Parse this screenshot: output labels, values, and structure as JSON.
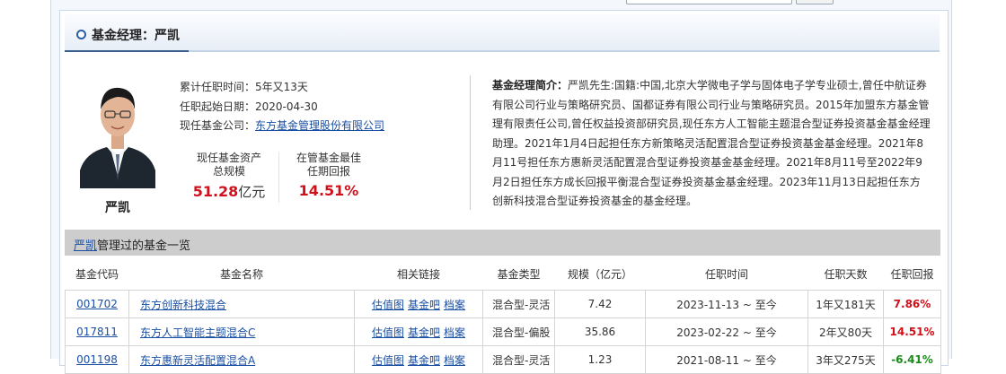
{
  "section": {
    "title": "基金经理：严凯"
  },
  "manager": {
    "name": "严凯",
    "tenure_label": "累计任职时间：",
    "tenure_value": "5年又13天",
    "start_label": "任职起始日期：",
    "start_value": "2020-04-30",
    "company_label": "现任基金公司：",
    "company_value": "东方基金管理股份有限公司"
  },
  "stats": {
    "aum_label_1": "现任基金资产",
    "aum_label_2": "总规模",
    "aum_value": "51.28",
    "aum_unit": "亿元",
    "best_label_1": "在管基金最佳",
    "best_label_2": "任期回报",
    "best_value": "14.51%"
  },
  "bio": {
    "label": "基金经理简介：",
    "text": "严凯先生:国籍:中国,北京大学微电子学与固体电子学专业硕士,曾任中航证券有限公司行业与策略研究员、国都证券有限公司行业与策略研究员。2015年加盟东方基金管理有限责任公司,曾任权益投资部研究员,现任东方人工智能主题混合型证券投资基金基金经理助理。2021年1月4日起担任东方新策略灵活配置混合型证券投资基金基金经理。2021年8月11号担任东方惠新灵活配置混合型证券投资基金基金经理。2021年8月11号至2022年9月2日担任东方成长回报平衡混合型证券投资基金基金经理。2023年11月13日起担任东方创新科技混合型证券投资基金的基金经理。"
  },
  "list": {
    "name_link": "严凯",
    "title_suffix": "管理过的基金一览",
    "headers": [
      "基金代码",
      "基金名称",
      "相关链接",
      "基金类型",
      "规模（亿元）",
      "任职时间",
      "任职天数",
      "任职回报"
    ],
    "link_labels": [
      "估值图",
      "基金吧",
      "档案"
    ],
    "rows": [
      {
        "code": "001702",
        "name": "东方创新科技混合",
        "type": "混合型-灵活",
        "scale": "7.42",
        "period": "2023-11-13 ~ 至今",
        "days": "1年又181天",
        "return": "7.86%"
      },
      {
        "code": "017811",
        "name": "东方人工智能主题混合C",
        "type": "混合型-偏股",
        "scale": "35.86",
        "period": "2023-02-22 ~ 至今",
        "days": "2年又80天",
        "return": "14.51%"
      },
      {
        "code": "001198",
        "name": "东方惠新灵活配置混合A",
        "type": "混合型-灵活",
        "scale": "1.23",
        "period": "2021-08-11 ~ 至今",
        "days": "3年又275天",
        "return": "-6.41%"
      }
    ]
  },
  "colors": {
    "accent": "#1a4fa3",
    "positive": "#d0101a",
    "negative": "#1a8a1a",
    "list_bar": "#cdcdcd"
  }
}
